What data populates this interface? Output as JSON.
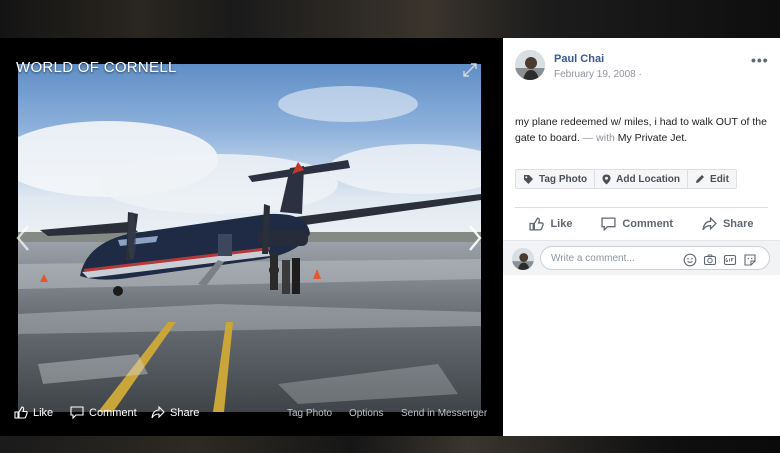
{
  "viewer": {
    "album_title": "WORLD OF CORNELL",
    "actions": {
      "like": "Like",
      "comment": "Comment",
      "share": "Share"
    },
    "links": {
      "tag_photo": "Tag Photo",
      "options": "Options",
      "send_messenger": "Send in Messenger"
    }
  },
  "post": {
    "author": "Paul Chai",
    "date": "February 19, 2008",
    "date_suffix": " ·",
    "text": "my plane redeemed w/ miles, i had to walk OUT of the gate to board.",
    "with_prefix": " — with ",
    "tagged": "My Private Jet",
    "period": ".",
    "more": "•••"
  },
  "tag_bar": {
    "tag_photo": "Tag Photo",
    "add_location": "Add Location",
    "edit": "Edit"
  },
  "actions": {
    "like": "Like",
    "comment": "Comment",
    "share": "Share"
  },
  "comment": {
    "placeholder": "Write a comment..."
  },
  "icons": {
    "expand": "expand-icon",
    "prev": "chevron-left-icon",
    "next": "chevron-right-icon",
    "like": "thumbs-up-icon",
    "comment": "speech-bubble-icon",
    "share": "share-arrow-icon",
    "tag": "tag-icon",
    "location": "map-pin-icon",
    "edit": "pencil-icon",
    "emoji": "smiley-icon",
    "camera": "camera-icon",
    "gif": "gif-icon",
    "sticker": "sticker-icon"
  },
  "colors": {
    "link": "#385898",
    "muted": "#90949c",
    "action": "#606770",
    "sidebar_bg": "#ffffff",
    "viewer_bg": "#000000"
  }
}
